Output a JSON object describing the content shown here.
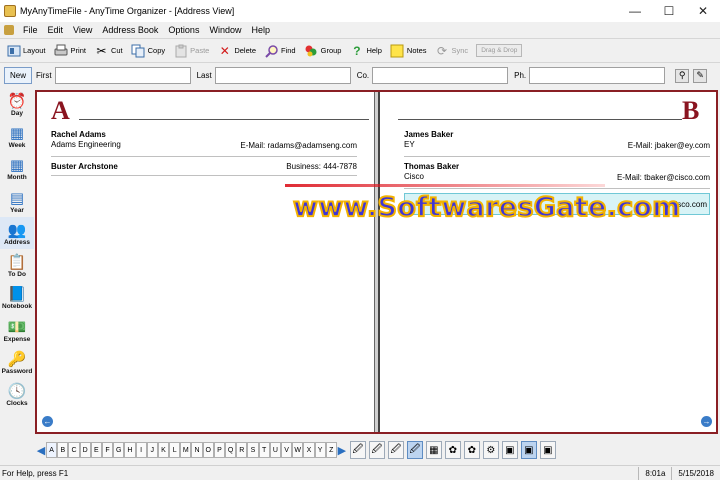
{
  "window": {
    "title": "MyAnyTimeFile - AnyTime Organizer - [Address View]",
    "controls": [
      "—",
      "☐",
      "✕"
    ]
  },
  "menu": [
    "File",
    "Edit",
    "View",
    "Address Book",
    "Options",
    "Window",
    "Help"
  ],
  "toolbar": {
    "layout": "Layout",
    "print": "Print",
    "cut": "Cut",
    "copy": "Copy",
    "paste": "Paste",
    "delete": "Delete",
    "find": "Find",
    "group": "Group",
    "help": "Help",
    "notes": "Notes",
    "sync": "Sync",
    "dragdrop": "Drag & Drop"
  },
  "search": {
    "new_label": "New",
    "first_label": "First",
    "last_label": "Last",
    "co_label": "Co.",
    "ph_label": "Ph.",
    "first_value": "",
    "last_value": "",
    "co_value": "",
    "ph_value": ""
  },
  "sidebar": {
    "items": [
      {
        "label": "Day",
        "icon": "⏰"
      },
      {
        "label": "Week",
        "icon": "▦"
      },
      {
        "label": "Month",
        "icon": "▦"
      },
      {
        "label": "Year",
        "icon": "▤"
      },
      {
        "label": "Address",
        "icon": "👥"
      },
      {
        "label": "To Do",
        "icon": "📋"
      },
      {
        "label": "Notebook",
        "icon": "📘"
      },
      {
        "label": "Expense",
        "icon": "💵"
      },
      {
        "label": "Password",
        "icon": "🔑"
      },
      {
        "label": "Clocks",
        "icon": "🕓"
      }
    ]
  },
  "book": {
    "left_letter": "A",
    "right_letter": "B",
    "left_entries": [
      {
        "name": "Rachel Adams",
        "sub": "Adams Engineering",
        "right": "E-Mail: radams@adamseng.com"
      },
      {
        "name": "Buster Archstone",
        "sub": "",
        "right": "Business: 444-7878"
      }
    ],
    "right_entries": [
      {
        "name": "James Baker",
        "sub": "EY",
        "right": "E-Mail: jbaker@ey.com"
      },
      {
        "name": "Thomas Baker",
        "sub": "Cisco",
        "right": "E-Mail: tbaker@cisco.com"
      },
      {
        "name": "",
        "sub": "",
        "right": "cisco.com"
      }
    ]
  },
  "watermark": "www.SoftwaresGate.com",
  "alphabet": [
    "A",
    "B",
    "C",
    "D",
    "E",
    "F",
    "G",
    "H",
    "I",
    "J",
    "K",
    "L",
    "M",
    "N",
    "O",
    "P",
    "Q",
    "R",
    "S",
    "T",
    "U",
    "V",
    "W",
    "X",
    "Y",
    "Z"
  ],
  "status": {
    "message": "For Help, press F1",
    "time": "8:01a",
    "date": "5/15/2018"
  },
  "colors": {
    "book_border": "#8a1f24",
    "letter": "#8a1420",
    "watermark_fill": "#3f35d6",
    "watermark_stroke": "#f3b200",
    "selection": "#d8f3f6"
  }
}
